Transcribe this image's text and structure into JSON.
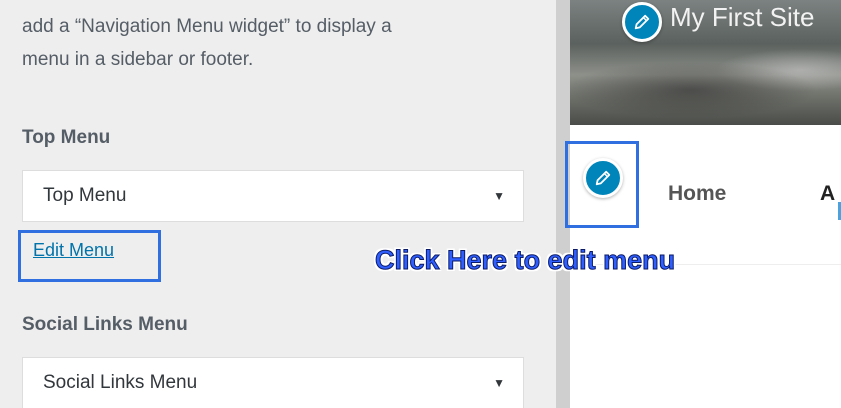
{
  "panel": {
    "description_line1": "add a “Navigation Menu widget” to display a",
    "description_line2": "menu in a sidebar or footer.",
    "top_menu": {
      "label": "Top Menu",
      "selected": "Top Menu"
    },
    "edit_menu_link": "Edit Menu",
    "social_menu": {
      "label": "Social Links Menu",
      "selected": "Social Links Menu"
    }
  },
  "preview": {
    "site_title": "My First Site",
    "nav_items": [
      "Home",
      "A"
    ]
  },
  "annotation": {
    "callout_text": "Click Here to edit menu",
    "highlight_color": "#2f6fe0"
  },
  "icons": {
    "edit_shortcut": "pencil-icon",
    "select_arrow": "caret-down-icon"
  },
  "colors": {
    "link": "#0073aa",
    "shortcut_blue": "#0085ba",
    "panel_bg": "#eeeeee"
  }
}
